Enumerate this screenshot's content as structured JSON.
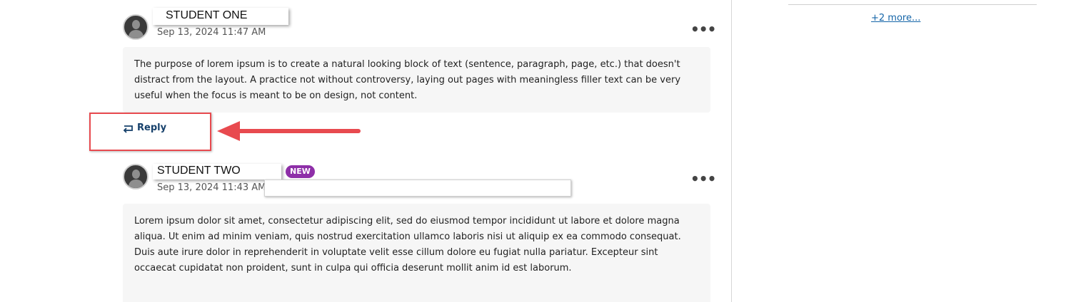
{
  "sidebar": {
    "more_link": "+2 more..."
  },
  "posts": [
    {
      "author": "STUDENT ONE",
      "timestamp": "Sep 13, 2024 11:47 AM",
      "body": "The purpose of lorem ipsum is to create a natural looking block of text (sentence, paragraph, page, etc.) that doesn't distract from the layout. A practice not without controversy, laying out pages with meaningless filler text can be very useful when the focus is meant to be on design, not content.",
      "reply_label": "Reply"
    },
    {
      "author": "STUDENT TWO",
      "badge": "NEW",
      "timestamp": "Sep 13, 2024 11:43 AM",
      "body": "Lorem ipsum dolor sit amet, consectetur adipiscing elit, sed do eiusmod tempor incididunt ut labore et dolore magna aliqua. Ut enim ad minim veniam, quis nostrud exercitation ullamco laboris nisi ut aliquip ex ea commodo consequat. Duis aute irure dolor in reprehenderit in voluptate velit esse cillum dolore eu fugiat nulla pariatur. Excepteur sint occaecat cupidatat non proident, sunt in culpa qui officia deserunt mollit anim id est laborum."
    }
  ],
  "icons": {
    "menu": "more-horizontal-icon",
    "reply": "reply-icon",
    "avatar": "user-avatar-icon"
  },
  "colors": {
    "badge": "#8e2fa8",
    "link": "#1565a8",
    "reply": "#16406b",
    "annotation": "#e84a4f"
  }
}
